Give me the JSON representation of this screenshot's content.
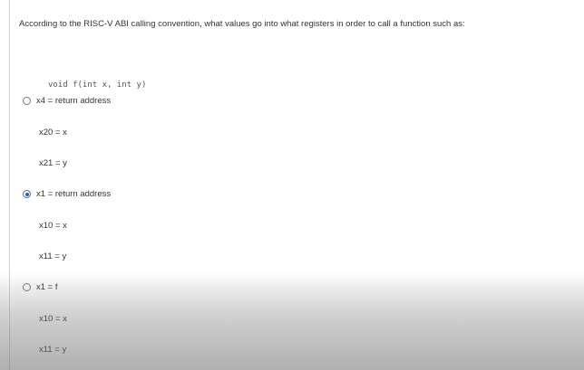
{
  "question": {
    "text": "According to the RISC-V ABI calling convention, what values go into what registers in order to call a function such as:"
  },
  "code": {
    "signature": "void f(int x, int y)"
  },
  "options": [
    {
      "selected": false,
      "lines": [
        "x4 = return address",
        "x20 = x",
        "x21 = y"
      ]
    },
    {
      "selected": true,
      "lines": [
        "x1 = return address",
        "x10 = x",
        "x11 = y"
      ]
    },
    {
      "selected": false,
      "lines": [
        "x1 = f",
        "x10 = x",
        "x11 = y"
      ]
    }
  ],
  "colors": {
    "selected_radio": "#2a5ea8",
    "text": "#333333"
  }
}
